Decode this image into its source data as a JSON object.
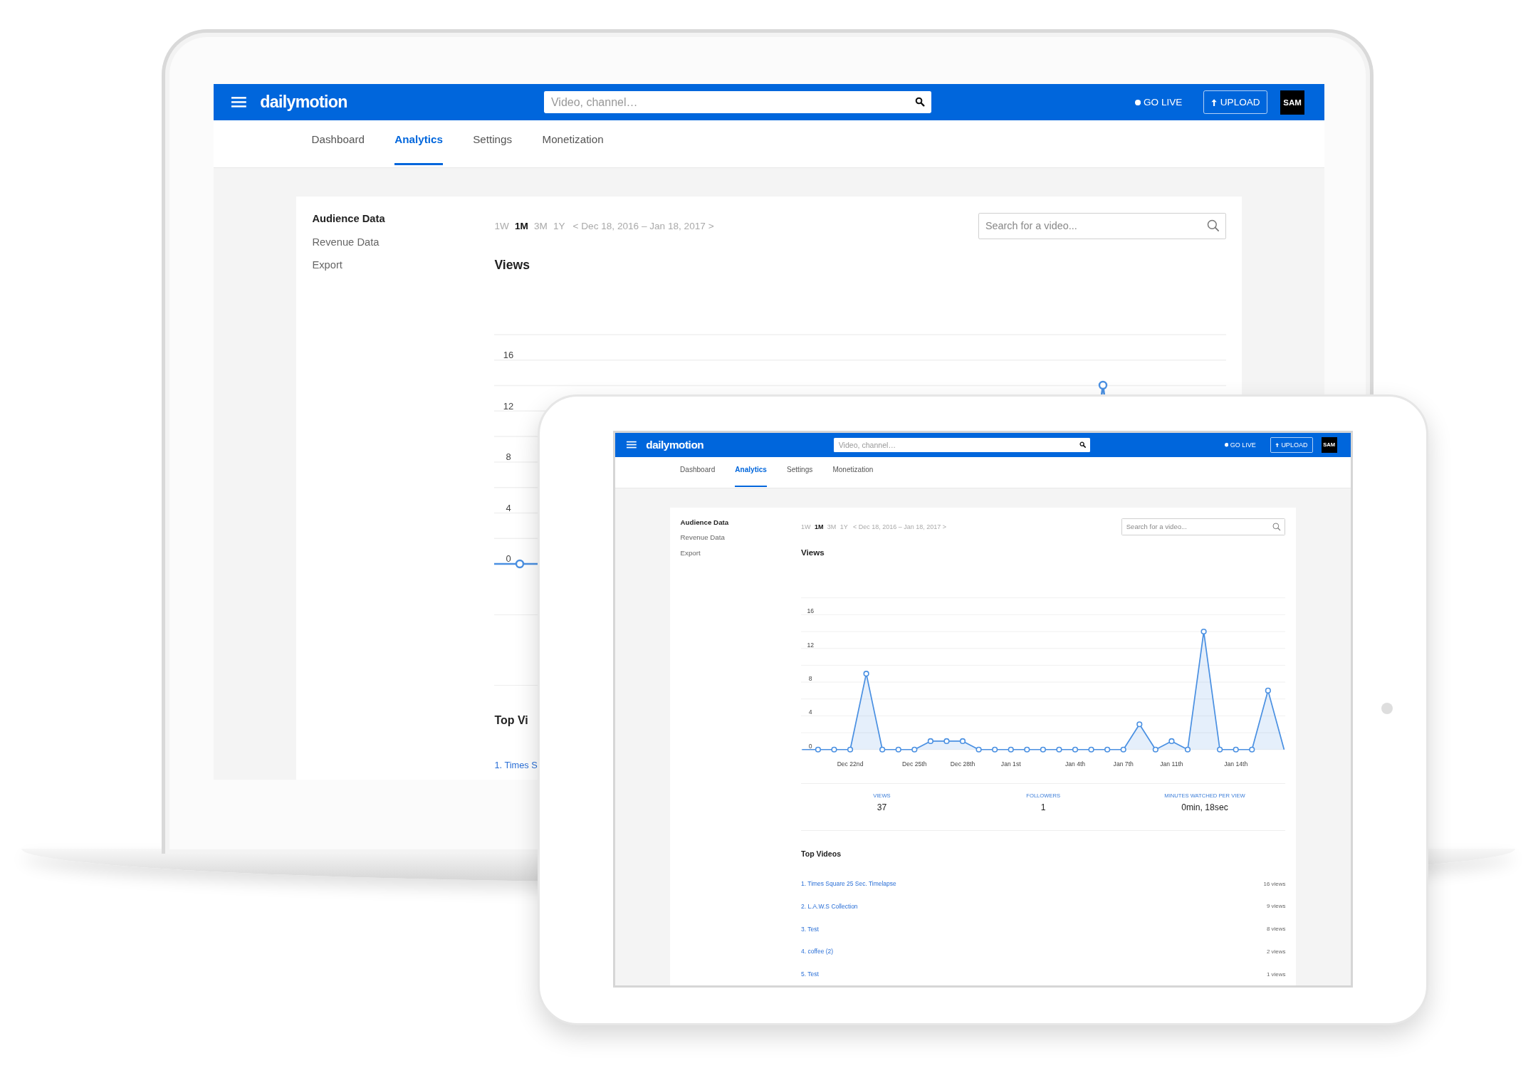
{
  "screens": [
    {
      "kind": "laptop",
      "header": {
        "logo": "dailymotion",
        "search_placeholder": "Video, channel…",
        "go_live": "GO LIVE",
        "upload": "UPLOAD",
        "avatar": "SAM"
      },
      "tabs": [
        {
          "label": "Dashboard",
          "selected": false
        },
        {
          "label": "Analytics",
          "selected": true
        },
        {
          "label": "Settings",
          "selected": false
        },
        {
          "label": "Monetization",
          "selected": false
        }
      ],
      "sidebar": [
        {
          "label": "Audience Data",
          "selected": true
        },
        {
          "label": "Revenue Data",
          "selected": false
        },
        {
          "label": "Export",
          "selected": false
        }
      ],
      "ranges": [
        {
          "label": "1W",
          "selected": false
        },
        {
          "label": "1M",
          "selected": true
        },
        {
          "label": "3M",
          "selected": false
        },
        {
          "label": "1Y",
          "selected": false
        }
      ],
      "date_range": "< Dec 18, 2016 – Jan 18, 2017 >",
      "video_search": {
        "placeholder": "Search for a video..."
      },
      "section_title": "Views",
      "chart": {
        "y_labels": [
          "16",
          "12",
          "8",
          "4",
          "0"
        ]
      },
      "top_videos": {
        "title": "Top Vi",
        "items": [
          {
            "title": "1. Times S"
          }
        ]
      }
    },
    {
      "kind": "tablet",
      "header": {
        "logo": "dailymotion",
        "search_placeholder": "Video, channel…",
        "go_live": "GO LIVE",
        "upload": "UPLOAD",
        "avatar": "SAM"
      },
      "tabs": [
        {
          "label": "Dashboard",
          "selected": false
        },
        {
          "label": "Analytics",
          "selected": true
        },
        {
          "label": "Settings",
          "selected": false
        },
        {
          "label": "Monetization",
          "selected": false
        }
      ],
      "sidebar": [
        {
          "label": "Audience Data",
          "selected": true
        },
        {
          "label": "Revenue Data",
          "selected": false
        },
        {
          "label": "Export",
          "selected": false
        }
      ],
      "ranges": [
        {
          "label": "1W",
          "selected": false
        },
        {
          "label": "1M",
          "selected": true
        },
        {
          "label": "3M",
          "selected": false
        },
        {
          "label": "1Y",
          "selected": false
        }
      ],
      "date_range": "< Dec 18, 2016 – Jan 18, 2017 >",
      "video_search": {
        "placeholder": "Search for a video..."
      },
      "chart_data": {
        "type": "area",
        "title": "Views",
        "categories": [
          null,
          null,
          null,
          "Dec 22nd",
          null,
          null,
          null,
          "Dec 25th",
          null,
          null,
          "Dec 28th",
          null,
          null,
          "Jan 1st",
          null,
          null,
          null,
          "Jan 4th",
          null,
          null,
          "Jan 7th",
          null,
          null,
          "Jan 11th",
          null,
          null,
          null,
          "Jan 14th",
          null,
          null,
          null
        ],
        "series": [
          {
            "color": "#4a90e2",
            "values": [
              0,
              0,
              0,
              0,
              9,
              0,
              0,
              0,
              1,
              1,
              1,
              0,
              0,
              0,
              0,
              0,
              0,
              0,
              0,
              0,
              0,
              3,
              0,
              1,
              0,
              14,
              0,
              0,
              0,
              7,
              0
            ]
          }
        ],
        "ylim": [
          0,
          18
        ],
        "yticks": [
          0,
          4,
          8,
          12,
          16
        ],
        "grid": true
      },
      "stats": [
        {
          "label": "VIEWS",
          "value": "37"
        },
        {
          "label": "FOLLOWERS",
          "value": "1"
        },
        {
          "label": "MINUTES WATCHED PER VIEW",
          "value": "0min, 18sec"
        }
      ],
      "top_videos": {
        "title": "Top Videos",
        "items": [
          {
            "title": "1. Times Square 25 Sec. Timelapse",
            "views": "16 views"
          },
          {
            "title": "2. L.A.W.S Collection",
            "views": "9 views"
          },
          {
            "title": "3. Test",
            "views": "8 views"
          },
          {
            "title": "4. coffee (2)",
            "views": "2 views"
          },
          {
            "title": "5. Test",
            "views": "1 views"
          }
        ]
      }
    }
  ]
}
